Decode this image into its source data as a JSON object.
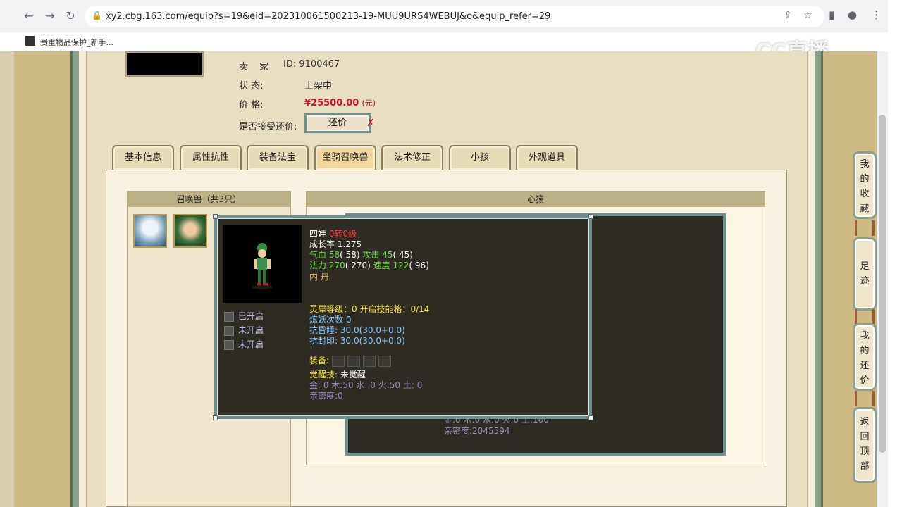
{
  "browser": {
    "url": "xy2.cbg.163.com/equip?s=19&eid=202310061500213-19-MUU9URS4WEBUJ&o&equip_refer=29",
    "bookmark": "贵重物品保护_新手...",
    "watermark": "CC直播"
  },
  "info": {
    "seller_label": "卖 家",
    "seller_value": "ID:  9100467",
    "status_label": "状     态:",
    "status_value": "上架中",
    "price_label": "价     格:",
    "price_value": "¥25500.00",
    "price_unit": "(元)",
    "counter_label": "是否接受还价:",
    "counter_button": "还价"
  },
  "tabs": [
    "基本信息",
    "属性抗性",
    "装备法宝",
    "坐骑召唤兽",
    "法术修正",
    "小孩",
    "外观道具"
  ],
  "summon_panel": {
    "title": "召唤兽（共3只）"
  },
  "right_panel": {
    "title": "心猿"
  },
  "back_popup": {
    "line1": "金:0 木:0 水:0 火:0 土:100",
    "line2": "亲密度:2045594"
  },
  "popup": {
    "name": "四娃",
    "level": "0转0级",
    "growth": "成长率 1.275",
    "hp_label": "气血",
    "hp_value": "58",
    "hp_base": "( 58)",
    "atk_label": "攻击",
    "atk_value": "45",
    "atk_base": "( 45)",
    "mp_label": "法力",
    "mp_value": "270",
    "mp_base": "( 270)",
    "spd_label": "速度",
    "spd_value": "122",
    "spd_base": "( 96)",
    "neidan": "内    丹",
    "lingxi": "灵犀等级：0 开启技能格：0/14",
    "lianyao": "炼妖次数 0",
    "resist_sleep": "抗昏睡: 30.0(30.0+0.0)",
    "resist_seal": "抗封印: 30.0(30.0+0.0)",
    "equip_label": "装备:",
    "awaken_label": "觉醒技:",
    "awaken_value": "未觉醒",
    "elements": "金: 0 木:50 水: 0 火:50 土: 0",
    "intimacy": "亲密度:0",
    "slots": [
      "已开启",
      "未开启",
      "未开启"
    ]
  },
  "side_nav": [
    {
      "chars": [
        "我",
        "的",
        "收",
        "藏"
      ]
    },
    {
      "chars": [
        "足",
        "迹"
      ]
    },
    {
      "chars": [
        "我",
        "的",
        "还",
        "价"
      ]
    },
    {
      "chars": [
        "返",
        "回",
        "顶",
        "部"
      ]
    }
  ]
}
